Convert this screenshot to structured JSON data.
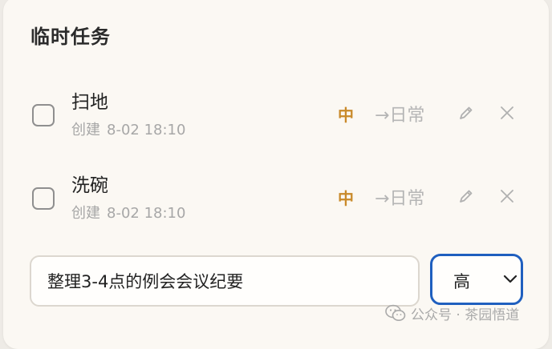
{
  "section": {
    "title": "临时任务"
  },
  "tasks": [
    {
      "title": "扫地",
      "created_label": "创建",
      "created_time": "8-02 18:10",
      "priority": "中",
      "move_label": "→日常",
      "edit_icon": "pencil-icon",
      "delete_icon": "close-icon",
      "checked": false
    },
    {
      "title": "洗碗",
      "created_label": "创建",
      "created_time": "8-02 18:10",
      "priority": "中",
      "move_label": "→日常",
      "edit_icon": "pencil-icon",
      "delete_icon": "close-icon",
      "checked": false
    }
  ],
  "new_task": {
    "value": "整理3-4点的例会会议纪要",
    "priority_selected": "高"
  },
  "watermark": {
    "text": "公众号 · 茶园悟道",
    "icon": "wechat-icon"
  },
  "colors": {
    "priority_medium": "#c98a2a",
    "focus_border": "#1f5fbf",
    "muted_text": "#a7a7a7"
  }
}
